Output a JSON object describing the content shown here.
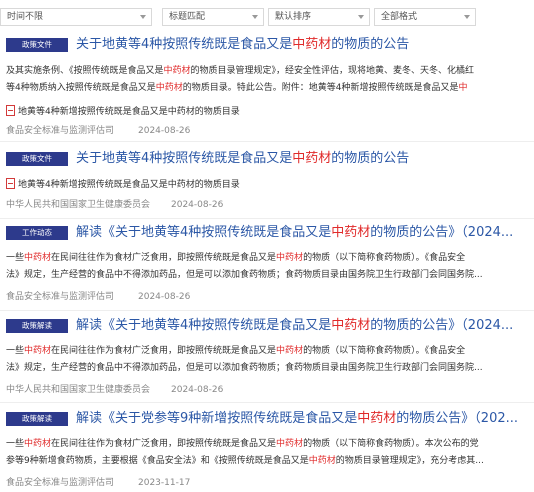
{
  "filters": {
    "time": "时间不限",
    "match": "标题匹配",
    "sort": "默认排序",
    "format": "全部格式"
  },
  "results": [
    {
      "badge": "政策文件",
      "title_pre": "关于地黄等4种按照传统既是食品又是",
      "title_hl": "中药材",
      "title_post": "的物质的公告",
      "snippet_l1_a": "及其实施条例、《按照传统既是食品又是",
      "snippet_l1_hl": "中药材",
      "snippet_l1_b": "的物质目录管理规定》，经安全性评估，现将地黄、麦冬、天冬、化橘红",
      "snippet_l2_a": "等4种物质纳入按照传统既是食品又是",
      "snippet_l2_hl": "中药材",
      "snippet_l2_b": "的物质目录。特此公告。附件：地黄等4种新增按照传统既是食品又是",
      "snippet_l2_hl2": "中",
      "attachment": "地黄等4种新增按照传统既是食品又是中药材的物质目录",
      "source": "食品安全标准与监测评估司",
      "date": "2024-08-26"
    },
    {
      "badge": "政策文件",
      "title_pre": "关于地黄等4种按照传统既是食品又是",
      "title_hl": "中药材",
      "title_post": "的物质的公告",
      "attachment": "地黄等4种新增按照传统既是食品又是中药材的物质目录",
      "source": "中华人民共和国国家卫生健康委员会",
      "date": "2024-08-26"
    },
    {
      "badge": "工作动态",
      "title_pre": "解读《关于地黄等4种按照传统既是食品又是",
      "title_hl": "中药材",
      "title_post": "的物质的公告》（2024...",
      "snippet_l1_a": "一些",
      "snippet_l1_hl": "中药材",
      "snippet_l1_b": "在民间往往作为食材广泛食用，即按照传统既是食品又是",
      "snippet_l1_hl2": "中药材",
      "snippet_l1_c": "的物质（以下简称食药物质）。《食品安全",
      "snippet_l2": "法》规定，生产经营的食品中不得添加药品，但是可以添加食药物质；食药物质目录由国务院卫生行政部门会同国务院...",
      "source": "食品安全标准与监测评估司",
      "date": "2024-08-26"
    },
    {
      "badge": "政策解读",
      "title_pre": "解读《关于地黄等4种按照传统既是食品又是",
      "title_hl": "中药材",
      "title_post": "的物质的公告》（2024...",
      "snippet_l1_a": "一些",
      "snippet_l1_hl": "中药材",
      "snippet_l1_b": "在民间往往作为食材广泛食用，即按照传统既是食品又是",
      "snippet_l1_hl2": "中药材",
      "snippet_l1_c": "的物质（以下简称食药物质）。《食品安全",
      "snippet_l2": "法》规定，生产经营的食品中不得添加药品，但是可以添加食药物质；食药物质目录由国务院卫生行政部门会同国务院...",
      "source": "中华人民共和国国家卫生健康委员会",
      "date": "2024-08-26"
    },
    {
      "badge": "政策解读",
      "title_pre": "解读《关于党参等9种新增按照传统既是食品又是",
      "title_hl": "中药材",
      "title_post": "的物质公告》（202...",
      "snippet_l1_a": "一些",
      "snippet_l1_hl": "中药材",
      "snippet_l1_b": "在民间往往作为食材广泛食用，即按照传统既是食品又是",
      "snippet_l1_hl2": "中药材",
      "snippet_l1_c": "的物质（以下简称食药物质）。本次公布的党",
      "snippet_l2_a": "参等9种新增食药物质，主要根据《食品安全法》和《按照传统既是食品又是",
      "snippet_l2_hl": "中药材",
      "snippet_l2_b": "的物质目录管理规定》，充分考虑其...",
      "source": "食品安全标准与监测评估司",
      "date": "2023-11-17"
    }
  ]
}
